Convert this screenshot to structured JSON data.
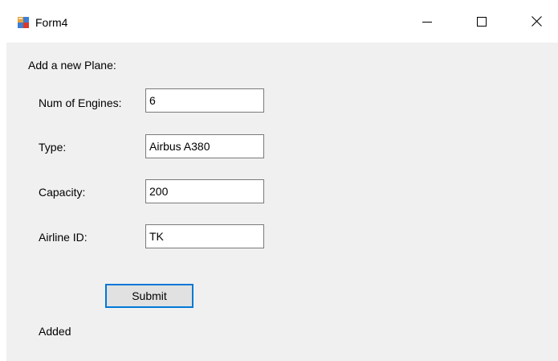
{
  "window": {
    "title": "Form4",
    "icon": "winforms-app-icon",
    "controls": {
      "minimize_icon": "minimize-icon",
      "maximize_icon": "maximize-icon",
      "close_icon": "close-icon"
    }
  },
  "form": {
    "heading": "Add a new Plane:",
    "fields": [
      {
        "label": "Num of Engines:",
        "value": "6"
      },
      {
        "label": "Type:",
        "value": "Airbus A380"
      },
      {
        "label": "Capacity:",
        "value": "200"
      },
      {
        "label": "Airline ID:",
        "value": "TK"
      }
    ],
    "submit_label": "Submit",
    "status": "Added"
  },
  "colors": {
    "client_background": "#f0f0f0",
    "focus_border": "#0078d7",
    "button_face": "#e1e1e1"
  }
}
